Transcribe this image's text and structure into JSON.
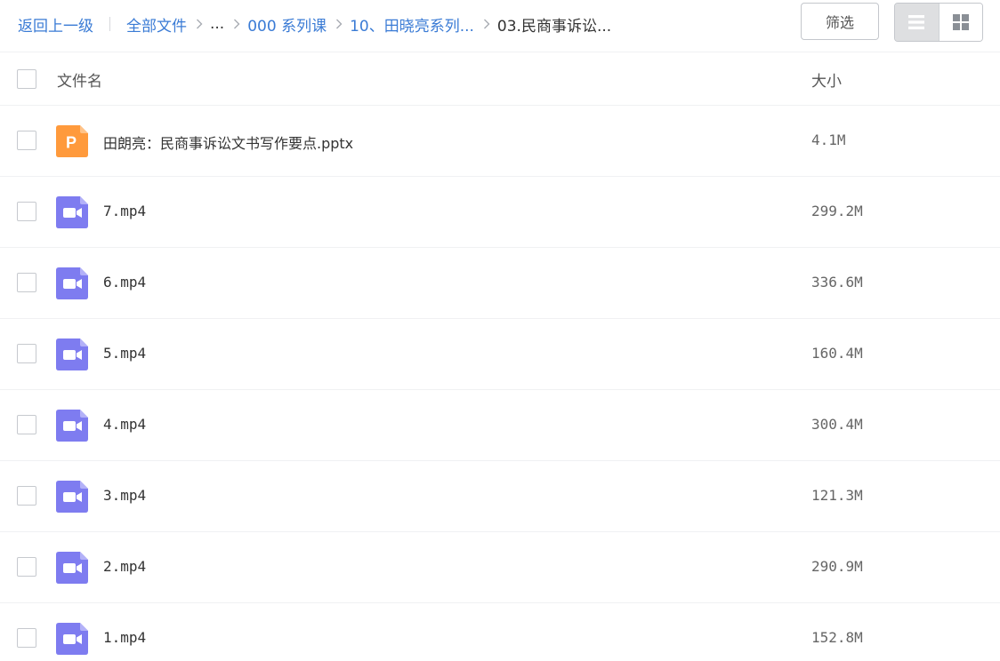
{
  "breadcrumb": {
    "back_label": "返回上一级",
    "items": [
      {
        "label": "全部文件",
        "kind": "link"
      },
      {
        "label": "...",
        "kind": "plain"
      },
      {
        "label": "000 系列课",
        "kind": "link"
      },
      {
        "label": "10、田晓亮系列...",
        "kind": "link"
      },
      {
        "label": "03.民商事诉讼...",
        "kind": "current"
      }
    ]
  },
  "toolbar": {
    "filter_label": "筛选",
    "view_modes": [
      "list",
      "grid"
    ],
    "active_view": "list"
  },
  "table": {
    "col_name": "文件名",
    "col_size": "大小"
  },
  "files": [
    {
      "name": "田朗亮：民商事诉讼文书写作要点.pptx",
      "size": "4.1M",
      "type": "ppt"
    },
    {
      "name": "7.mp4",
      "size": "299.2M",
      "type": "video"
    },
    {
      "name": "6.mp4",
      "size": "336.6M",
      "type": "video"
    },
    {
      "name": "5.mp4",
      "size": "160.4M",
      "type": "video"
    },
    {
      "name": "4.mp4",
      "size": "300.4M",
      "type": "video"
    },
    {
      "name": "3.mp4",
      "size": "121.3M",
      "type": "video"
    },
    {
      "name": "2.mp4",
      "size": "290.9M",
      "type": "video"
    },
    {
      "name": "1.mp4",
      "size": "152.8M",
      "type": "video"
    }
  ],
  "icons": {
    "ppt": {
      "color": "#ff9a3c",
      "letter": "P"
    },
    "video": {
      "color": "#7e7cf0"
    }
  },
  "colors": {
    "link": "#3a7bd5",
    "divider": "#f0f1f3"
  }
}
